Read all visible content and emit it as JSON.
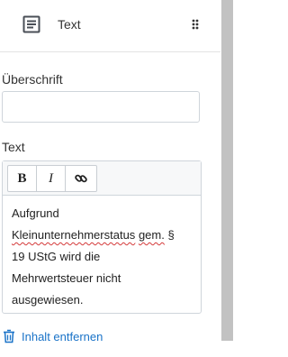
{
  "header": {
    "title": "Text"
  },
  "fields": {
    "heading_label": "Überschrift",
    "heading_value": "",
    "text_label": "Text"
  },
  "editor": {
    "toolbar": {
      "bold": "B",
      "italic": "I"
    },
    "content": {
      "line1": "Aufgrund",
      "line2_misspelled": "Kleinunternehmerstatus",
      "line2_gem": "gem.",
      "line2_rest": "§",
      "line3": "19 UStG wird die",
      "line4": "Mehrwertsteuer nicht",
      "line5": "ausgewiesen."
    }
  },
  "actions": {
    "remove_label": "Inhalt entfernen"
  },
  "colors": {
    "link": "#1a73c8",
    "scrollbar": "#c2c2c2",
    "spell_error": "#d43a3a"
  }
}
